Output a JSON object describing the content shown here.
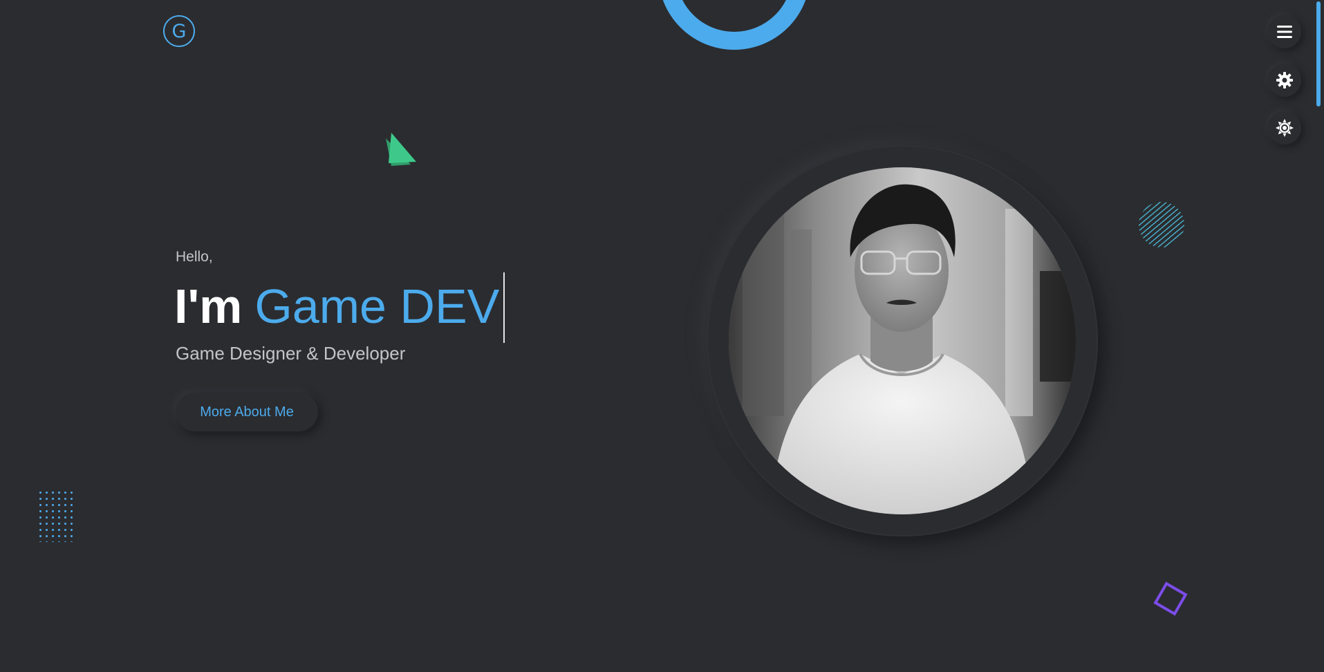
{
  "logo": {
    "letter": "G"
  },
  "hero": {
    "greeting": "Hello,",
    "intro": "I'm",
    "role": "Game DEV",
    "subtitle": "Game Designer & Developer",
    "cta_label": "More About Me"
  },
  "profile": {
    "photo_alt": "Profile photo"
  },
  "controls": [
    {
      "icon": "menu-icon"
    },
    {
      "icon": "gear-icon"
    },
    {
      "icon": "sun-icon"
    }
  ],
  "colors": {
    "background": "#2b2c30",
    "accent": "#4cabec",
    "green": "#3ec98a",
    "purple": "#7c4dea",
    "teal": "#4ab9d4"
  }
}
